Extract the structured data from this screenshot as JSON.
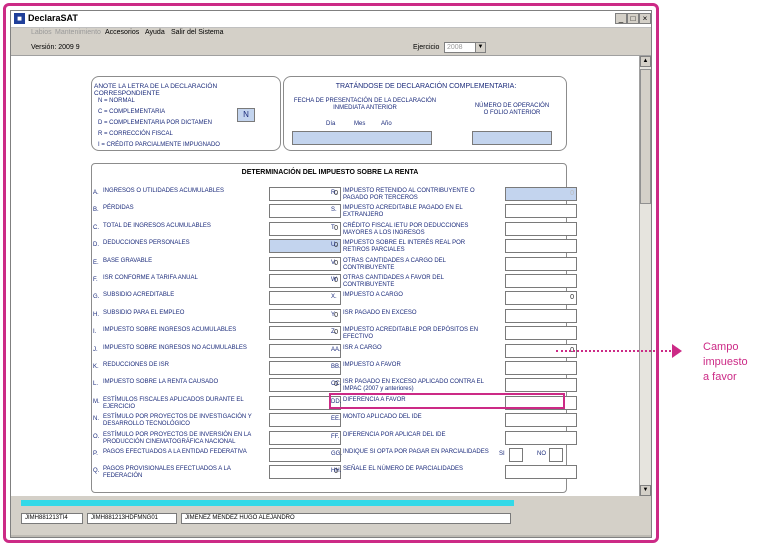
{
  "window": {
    "title": "DeclaraSAT",
    "controls": [
      "_",
      "□",
      "×"
    ]
  },
  "menu": [
    {
      "label": "Labios",
      "disabled": true
    },
    {
      "label": "Mantenimiento",
      "disabled": true
    },
    {
      "label": "Accesorios",
      "disabled": false
    },
    {
      "label": "Ayuda",
      "disabled": false
    },
    {
      "label": "Salir del Sistema",
      "disabled": false
    }
  ],
  "info": {
    "version": "Versión: 2009 9",
    "ejercicio_label": "Ejercicio",
    "ejercicio_value": "2008"
  },
  "declaration_type": {
    "title": "ANOTE LA LETRA DE LA DECLARACIÓN CORRESPONDIENTE",
    "options": [
      "N = NORMAL",
      "C = COMPLEMENTARIA",
      "D = COMPLEMENTARIA POR DICTAMEN",
      "R = CORRECCIÓN FISCAL",
      "I = CRÉDITO PARCIALMENTE IMPUGNADO"
    ],
    "value": "N"
  },
  "complementaria": {
    "title": "TRATÁNDOSE DE DECLARACIÓN COMPLEMENTARIA:",
    "fecha_label": "FECHA DE PRESENTACIÓN DE LA DECLARACIÓN INMEDIATA ANTERIOR",
    "dia": "Día",
    "mes": "Mes",
    "anio": "Año",
    "operacion_label": "NÚMERO DE OPERACIÓN O FOLIO ANTERIOR"
  },
  "isr": {
    "title": "DETERMINACIÓN DEL IMPUESTO SOBRE LA RENTA",
    "left": [
      {
        "letter": "A.",
        "label": "INGRESOS O UTILIDADES ACUMULABLES",
        "value": "0",
        "blue": false
      },
      {
        "letter": "B.",
        "label": "PÉRDIDAS",
        "value": "",
        "blue": false
      },
      {
        "letter": "C.",
        "label": "TOTAL DE INGRESOS ACUMULABLES",
        "value": "0",
        "blue": false
      },
      {
        "letter": "D.",
        "label": "DEDUCCIONES PERSONALES",
        "value": "0",
        "blue": true
      },
      {
        "letter": "E.",
        "label": "BASE GRAVABLE",
        "value": "0",
        "blue": false
      },
      {
        "letter": "F.",
        "label": "ISR CONFORME A TARIFA ANUAL",
        "value": "0",
        "blue": false
      },
      {
        "letter": "G.",
        "label": "SUBSIDIO ACREDITABLE",
        "value": "",
        "blue": false
      },
      {
        "letter": "H.",
        "label": "SUBSIDIO PARA EL EMPLEO",
        "value": "0",
        "blue": false
      },
      {
        "letter": "I.",
        "label": "IMPUESTO SOBRE INGRESOS ACUMULABLES",
        "value": "0",
        "blue": false
      },
      {
        "letter": "J.",
        "label": "IMPUESTO SOBRE INGRESOS NO ACUMULABLES",
        "value": "",
        "blue": false
      },
      {
        "letter": "K.",
        "label": "REDUCCIONES DE ISR",
        "value": "",
        "blue": false
      },
      {
        "letter": "L.",
        "label": "IMPUESTO SOBRE LA RENTA CAUSADO",
        "value": "0",
        "blue": false
      },
      {
        "letter": "M.",
        "label": "ESTÍMULOS FISCALES APLICADOS DURANTE EL EJERCICIO",
        "value": "",
        "blue": false
      },
      {
        "letter": "N.",
        "label": "ESTÍMULO POR PROYECTOS DE INVESTIGACIÓN Y DESARROLLO TECNOLÓGICO",
        "value": "",
        "blue": false
      },
      {
        "letter": "O.",
        "label": "ESTÍMULO POR PROYECTOS DE INVERSIÓN EN LA PRODUCCIÓN CINEMATOGRÁFICA NACIONAL",
        "value": "",
        "blue": false
      },
      {
        "letter": "P.",
        "label": "PAGOS EFECTUADOS A LA ENTIDAD FEDERATIVA",
        "value": "",
        "blue": false
      },
      {
        "letter": "Q.",
        "label": "PAGOS PROVISIONALES EFECTUADOS A LA FEDERACIÓN",
        "value": "0",
        "blue": false
      }
    ],
    "right": [
      {
        "letter": "R.",
        "label": "IMPUESTO RETENIDO AL CONTRIBUYENTE O PAGADO POR TERCEROS",
        "value": "0",
        "blue": true,
        "gray": true
      },
      {
        "letter": "S.",
        "label": "IMPUESTO ACREDITABLE PAGADO EN EL EXTRANJERO",
        "value": "",
        "blue": false
      },
      {
        "letter": "T.",
        "label": "CRÉDITO FISCAL IETU POR DEDUCCIONES MAYORES A LOS INGRESOS",
        "value": "",
        "blue": false
      },
      {
        "letter": "U.",
        "label": "IMPUESTO SOBRE EL INTERÉS REAL POR RETIROS PARCIALES",
        "value": "",
        "blue": false
      },
      {
        "letter": "V.",
        "label": "OTRAS CANTIDADES A CARGO DEL CONTRIBUYENTE",
        "value": "",
        "blue": false
      },
      {
        "letter": "W.",
        "label": "OTRAS CANTIDADES A FAVOR DEL CONTRIBUYENTE",
        "value": "",
        "blue": false
      },
      {
        "letter": "X.",
        "label": "IMPUESTO A CARGO",
        "value": "0",
        "blue": false
      },
      {
        "letter": "Y.",
        "label": "ISR PAGADO EN EXCESO",
        "value": "",
        "blue": false
      },
      {
        "letter": "Z.",
        "label": "IMPUESTO ACREDITABLE POR DEPÓSITOS EN EFECTIVO",
        "value": "",
        "blue": false
      },
      {
        "letter": "AA.",
        "label": "ISR A CARGO",
        "value": "0",
        "blue": false
      },
      {
        "letter": "BB.",
        "label": "IMPUESTO A FAVOR",
        "value": "",
        "blue": false
      },
      {
        "letter": "CC.",
        "label": "ISR PAGADO EN EXCESO APLICADO CONTRA EL IMPAC (2007 y anteriores)",
        "value": "",
        "blue": false
      },
      {
        "letter": "DD.",
        "label": "DIFERENCIA A FAVOR",
        "value": "",
        "blue": false
      },
      {
        "letter": "EE.",
        "label": "MONTO APLICADO DEL IDE",
        "value": "",
        "blue": false
      },
      {
        "letter": "FF.",
        "label": "DIFERENCIA POR APLICAR DEL IDE",
        "value": "",
        "blue": false
      },
      {
        "letter": "GG.",
        "label": "INDIQUE SI OPTA POR PAGAR EN PARCIALIDADES",
        "value": "",
        "blue": false
      },
      {
        "letter": "HH.",
        "label": "SEÑALE EL NÚMERO DE PARCIALIDADES",
        "value": "",
        "blue": false
      }
    ],
    "si_label": "SI",
    "no_label": "NO"
  },
  "status": {
    "rfc": "JIMH881213TI4",
    "curp": "JIMH881213HDFMNG01",
    "name": "JIMENEZ MENDEZ HUGO ALEJANDRO"
  },
  "callout": {
    "text": "Campo impuesto a favor",
    "color": "#cc2a86"
  }
}
